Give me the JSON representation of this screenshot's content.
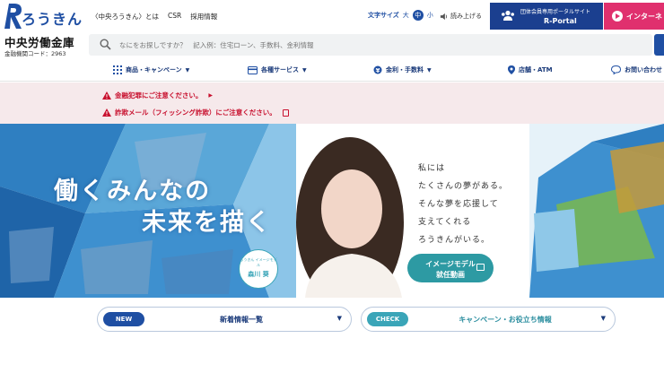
{
  "header": {
    "brand_kana": "ろうきん",
    "bank_name": "中央労働金庫",
    "bank_code": "金融機関コード：2963",
    "util_links": [
      "〈中央ろうきん〉とは",
      "CSR",
      "採用情報"
    ],
    "font_size_label": "文字サイズ",
    "font_sizes": [
      "大",
      "中",
      "小"
    ],
    "font_size_active": "中",
    "read_aloud": "読み上げる",
    "rportal_small": "団体会員専用ポータルサイト",
    "rportal_label": "R-Portal",
    "netbank_label": "インターネ",
    "search_placeholder": "なにをお探しですか？　記入例：住宅ローン、手数料、金利情報"
  },
  "nav": [
    {
      "label": "商品・キャンペーン",
      "icon": "grid-icon"
    },
    {
      "label": "各種サービス",
      "icon": "card-icon"
    },
    {
      "label": "金利・手数料",
      "icon": "yen-icon"
    },
    {
      "label": "店舗・ATM",
      "icon": "pin-icon"
    },
    {
      "label": "お問い合わせ",
      "icon": "chat-icon"
    }
  ],
  "alerts": [
    {
      "label": "金融犯罪にご注意ください。",
      "suffix": "arrow"
    },
    {
      "label": "詐欺メール（フィッシング詐欺）にご注意ください。",
      "suffix": "pdf"
    }
  ],
  "hero": {
    "tagline_1": "働くみんなの",
    "tagline_2": "未来を描く",
    "copy": [
      "私には",
      "たくさんの夢がある。",
      "そんな夢を応援して",
      "支えてくれる",
      "ろうきんがいる。"
    ],
    "badge_small": "ろうきん イメージモデル",
    "badge_name": "森川 葵",
    "movie_button_1": "イメージモデル",
    "movie_button_2": "就任動画"
  },
  "bottom": {
    "new_tag": "NEW",
    "new_label": "新着情報一覧",
    "check_tag": "CHECK",
    "check_label": "キャンペーン・お役立ち情報"
  },
  "colors": {
    "brand": "#1f4fa3",
    "alert_red": "#c8102e",
    "alert_bg": "#f6e9eb",
    "netbank_pink": "#e0306e",
    "teal": "#2d9aa3"
  }
}
